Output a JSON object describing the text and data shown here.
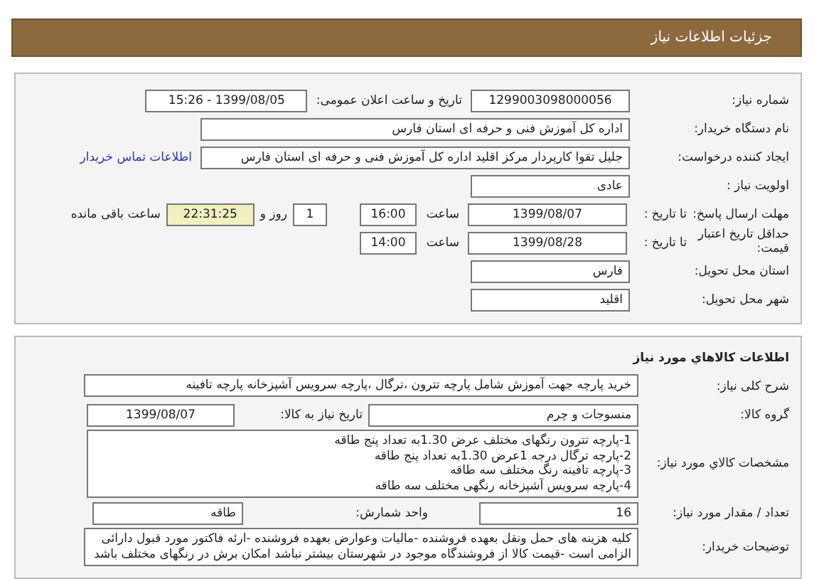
{
  "header": {
    "title": "جزئیات اطلاعات نیاز"
  },
  "details": {
    "need_number": {
      "label": "شماره نیاز:",
      "value": "1299003098000056"
    },
    "announce": {
      "label": "تاریخ و ساعت اعلان عمومی:",
      "value": "1399/08/05 - 15:26"
    },
    "buyer": {
      "label": "نام دستگاه خریدار:",
      "value": "اداره کل آموزش فنی و حرفه ای استان فارس"
    },
    "creator": {
      "label": "ایجاد کننده درخواست:",
      "value": "جلیل  تقوا کارپردار مرکز اقلید اداره کل آموزش فنی و حرفه ای استان فارس",
      "link": "اطلاعات تماس خریدار"
    },
    "priority": {
      "label": "اولویت نیاز :",
      "value": "عادی"
    },
    "deadline": {
      "label": "مهلت ارسال پاسخ:",
      "to_label": "تا تاریخ :",
      "date": "1399/08/07",
      "time_label": "ساعت",
      "time": "16:00",
      "days": "1",
      "days_label": "روز و",
      "remaining": "22:31:25",
      "remaining_label": "ساعت باقی مانده"
    },
    "validity": {
      "label": "حداقل تاریخ اعتبار قیمت:",
      "to_label": "تا تاریخ :",
      "date": "1399/08/28",
      "time_label": "ساعت",
      "time": "14:00"
    },
    "province": {
      "label": "استان محل تحویل:",
      "value": "فارس"
    },
    "city": {
      "label": "شهر محل تحویل:",
      "value": "اقلید"
    }
  },
  "goods": {
    "title": "اطلاعات کالاهاي مورد نیاز",
    "summary": {
      "label": "شرح کلی نیاز:",
      "value": "خرید پارچه جهت آموزش شامل پارچه تترون ،ترگال ،پارچه سرویس آشپزخانه پارچه تافینه"
    },
    "group": {
      "label": "گروه کالا:",
      "value": "منسوجات و چرم",
      "date_label": "تاریخ نیاز به کالا:",
      "date": "1399/08/07"
    },
    "specs": {
      "label": "مشخصات کالاي مورد نیاز:",
      "lines": [
        "1-پارچه تترون رنگهای مختلف عرض 1.30به تعداد پنج طاقه",
        "2-پارچه ترگال درجه 1عرض 1.30به تعداد پنج طاقه",
        "3-پارچه تافینه رنگ مختلف سه طاقه",
        "4-پارچه سرویس آشپزخانه رنگهی مختلف سه  طاقه"
      ]
    },
    "quantity": {
      "label": "تعداد / مقدار مورد نیاز:",
      "value": "16",
      "unit_label": "واحد شمارش:",
      "unit": "طاقه"
    },
    "notes": {
      "label": "توضیحات خریدار:",
      "value": "کلیه هزینه های حمل ونقل بعهده فروشنده -مالیات وعوارض بعهده فروشنده -ارئه فاکتور مورد قبول دارائی الزامی است -قیمت کالا از فروشندگاه موجود در شهرستان بیشتر نباشد امکان برش در رنگهای مختلف باشد"
    }
  }
}
